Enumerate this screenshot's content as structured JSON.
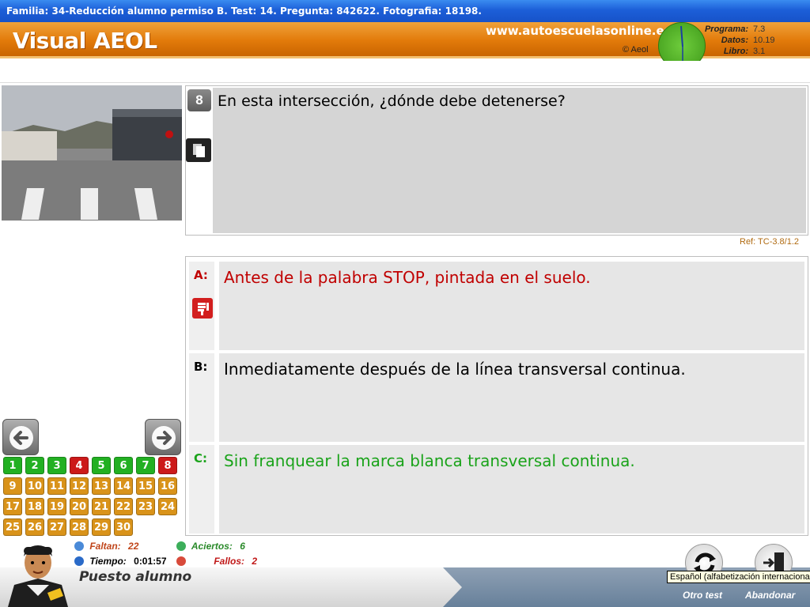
{
  "window": {
    "title": "Familia: 34-Reducción alumno permiso B. Test: 14. Pregunta: 842622. Fotografia: 18198."
  },
  "header": {
    "app_title": "Visual AEOL",
    "site_url": "www.autoescuelasonline.es",
    "copyright": "© Aeol",
    "versions": [
      {
        "label": "Programa:",
        "value": "7.3"
      },
      {
        "label": "Datos:",
        "value": "10.19"
      },
      {
        "label": "Libro:",
        "value": "3.1"
      }
    ]
  },
  "question": {
    "number": "8",
    "text": "En esta intersección, ¿dónde debe detenerse?",
    "ref": "Ref: TC-3.8/1.2"
  },
  "answers": [
    {
      "letter": "A:",
      "text": "Antes de la palabra STOP, pintada en el suelo.",
      "status": "wrong",
      "color": "#c00000"
    },
    {
      "letter": "B:",
      "text": "Inmediatamente después de la línea transversal continua.",
      "status": "neutral",
      "color": "#000000"
    },
    {
      "letter": "C:",
      "text": "Sin franquear la marca blanca transversal continua.",
      "status": "correct",
      "color": "#1aa31a"
    }
  ],
  "navigation": {
    "prev_icon": "arrow-left-icon",
    "next_icon": "arrow-right-icon",
    "questions": [
      {
        "n": "1",
        "state": "correct"
      },
      {
        "n": "2",
        "state": "correct"
      },
      {
        "n": "3",
        "state": "correct"
      },
      {
        "n": "4",
        "state": "wrong"
      },
      {
        "n": "5",
        "state": "correct"
      },
      {
        "n": "6",
        "state": "correct"
      },
      {
        "n": "7",
        "state": "correct"
      },
      {
        "n": "8",
        "state": "wrong"
      },
      {
        "n": "9",
        "state": "pending"
      },
      {
        "n": "10",
        "state": "pending"
      },
      {
        "n": "11",
        "state": "pending"
      },
      {
        "n": "12",
        "state": "pending"
      },
      {
        "n": "13",
        "state": "pending"
      },
      {
        "n": "14",
        "state": "pending"
      },
      {
        "n": "15",
        "state": "pending"
      },
      {
        "n": "16",
        "state": "pending"
      },
      {
        "n": "17",
        "state": "pending"
      },
      {
        "n": "18",
        "state": "pending"
      },
      {
        "n": "19",
        "state": "pending"
      },
      {
        "n": "20",
        "state": "pending"
      },
      {
        "n": "21",
        "state": "pending"
      },
      {
        "n": "22",
        "state": "pending"
      },
      {
        "n": "23",
        "state": "pending"
      },
      {
        "n": "24",
        "state": "pending"
      },
      {
        "n": "25",
        "state": "pending"
      },
      {
        "n": "26",
        "state": "pending"
      },
      {
        "n": "27",
        "state": "pending"
      },
      {
        "n": "28",
        "state": "pending"
      },
      {
        "n": "29",
        "state": "pending"
      },
      {
        "n": "30",
        "state": "pending"
      }
    ],
    "state_colors": {
      "correct": "#22b022",
      "wrong": "#cc1a1a",
      "pending": "#d9931a"
    }
  },
  "stats": {
    "faltan_label": "Faltan:",
    "faltan_value": "22",
    "tiempo_label": "Tiempo:",
    "tiempo_value": "0:01:57",
    "aciertos_label": "Aciertos:",
    "aciertos_value": "6",
    "fallos_label": "Fallos:",
    "fallos_value": "2"
  },
  "footer": {
    "label": "Puesto alumno",
    "otro_test": "Otro test",
    "abandonar": "Abandonar",
    "tooltip": "Español (alfabetización internacional)"
  }
}
